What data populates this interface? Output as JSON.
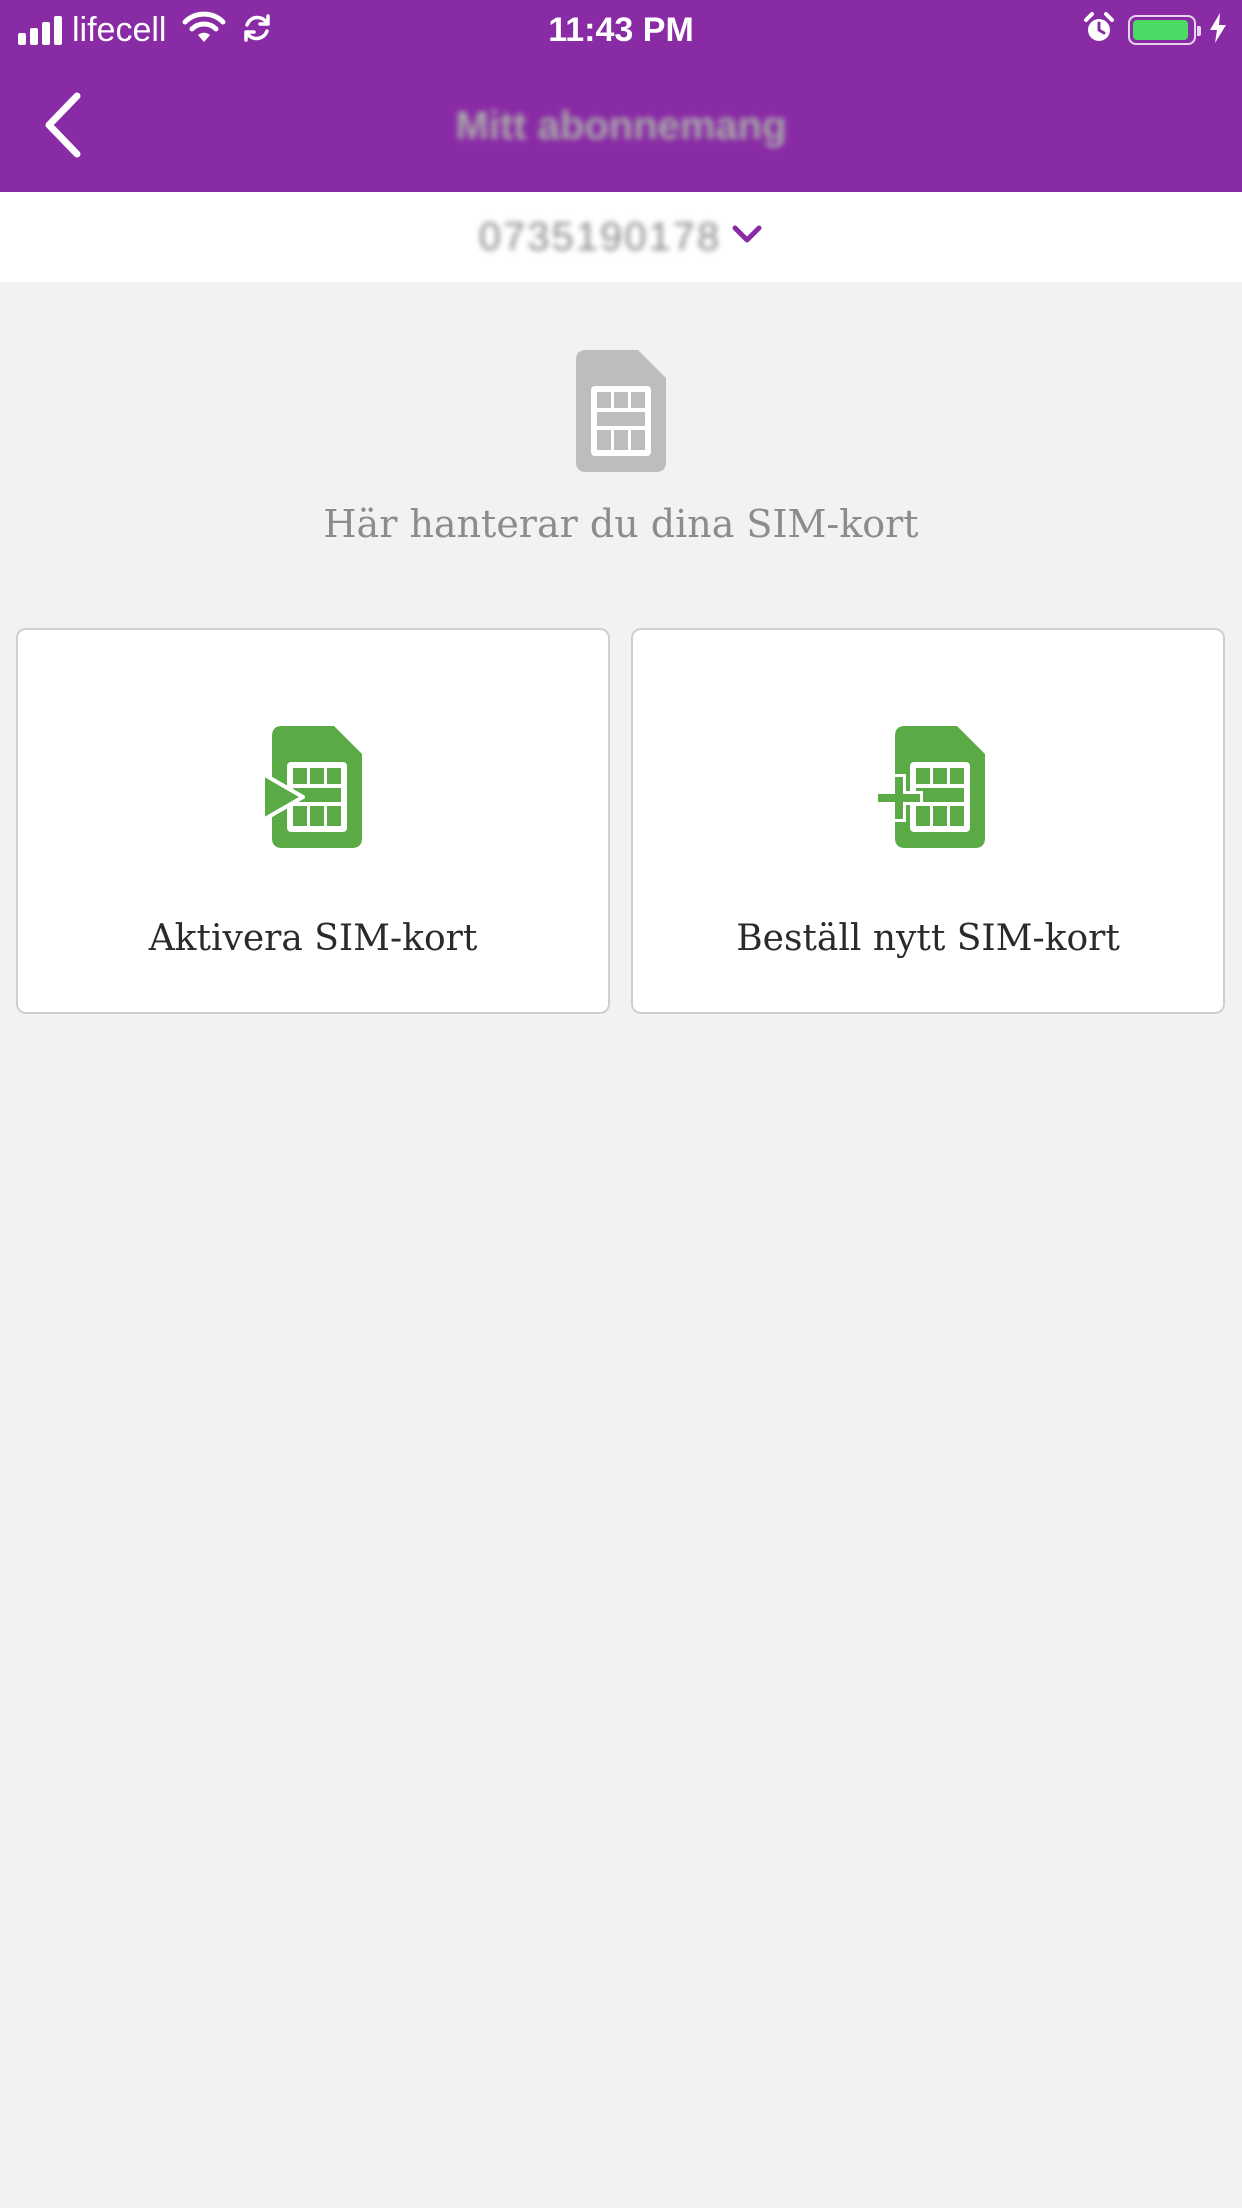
{
  "status_bar": {
    "carrier": "lifecell",
    "time": "11:43 PM",
    "battery_level": 0.95,
    "icons": [
      "signal-icon",
      "wifi-icon",
      "sync-icon",
      "alarm-icon",
      "battery-icon",
      "charging-icon"
    ]
  },
  "nav": {
    "title": "Mitt abonnemang",
    "back_icon": "chevron-left-icon"
  },
  "subscription": {
    "number": "0735190178",
    "dropdown_icon": "chevron-down-icon"
  },
  "main": {
    "intro_icon": "sim-card-icon",
    "intro_text": "Här hanterar du dina SIM-kort"
  },
  "cards": [
    {
      "label": "Aktivera SIM-kort",
      "icon": "sim-activate-icon"
    },
    {
      "label": "Beställ nytt SIM-kort",
      "icon": "sim-add-icon"
    }
  ],
  "colors": {
    "brand": "#8a2ba6",
    "accent_green": "#5aaa46",
    "background": "#f2f2f2"
  }
}
